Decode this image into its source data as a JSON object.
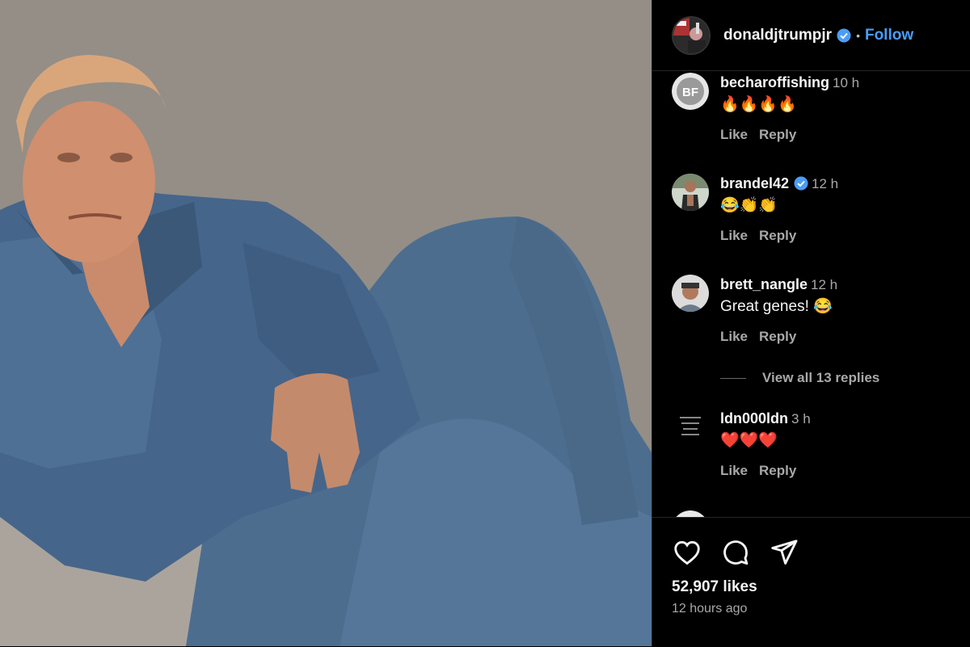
{
  "post": {
    "username": "donaldjtrumpjr",
    "separator": "•",
    "follow_label": "Follow",
    "likes": "52,907 likes",
    "time_ago": "12 hours ago"
  },
  "comments": [
    {
      "username": "becharoffishing",
      "time": "10 h",
      "text": "🔥🔥🔥🔥",
      "like_label": "Like",
      "reply_label": "Reply",
      "avatar": "BF"
    },
    {
      "username": "brandel42",
      "time": "12 h",
      "text": "😂👏👏",
      "like_label": "Like",
      "reply_label": "Reply",
      "verified": true
    },
    {
      "username": "brett_nangle",
      "time": "12 h",
      "text": "Great genes! 😂",
      "like_label": "Like",
      "reply_label": "Reply"
    },
    {
      "username": "ldn000ldn",
      "time": "3 h",
      "text": "❤️❤️❤️",
      "like_label": "Like",
      "reply_label": "Reply"
    }
  ],
  "view_replies_label": "View all 13 replies",
  "icons": [
    "heart-icon",
    "comment-icon",
    "share-icon",
    "verified-icon"
  ],
  "colors": {
    "background": "#000000",
    "accent": "#4a9df8",
    "muted": "#a8a8a8",
    "text": "#f5f5f5"
  }
}
